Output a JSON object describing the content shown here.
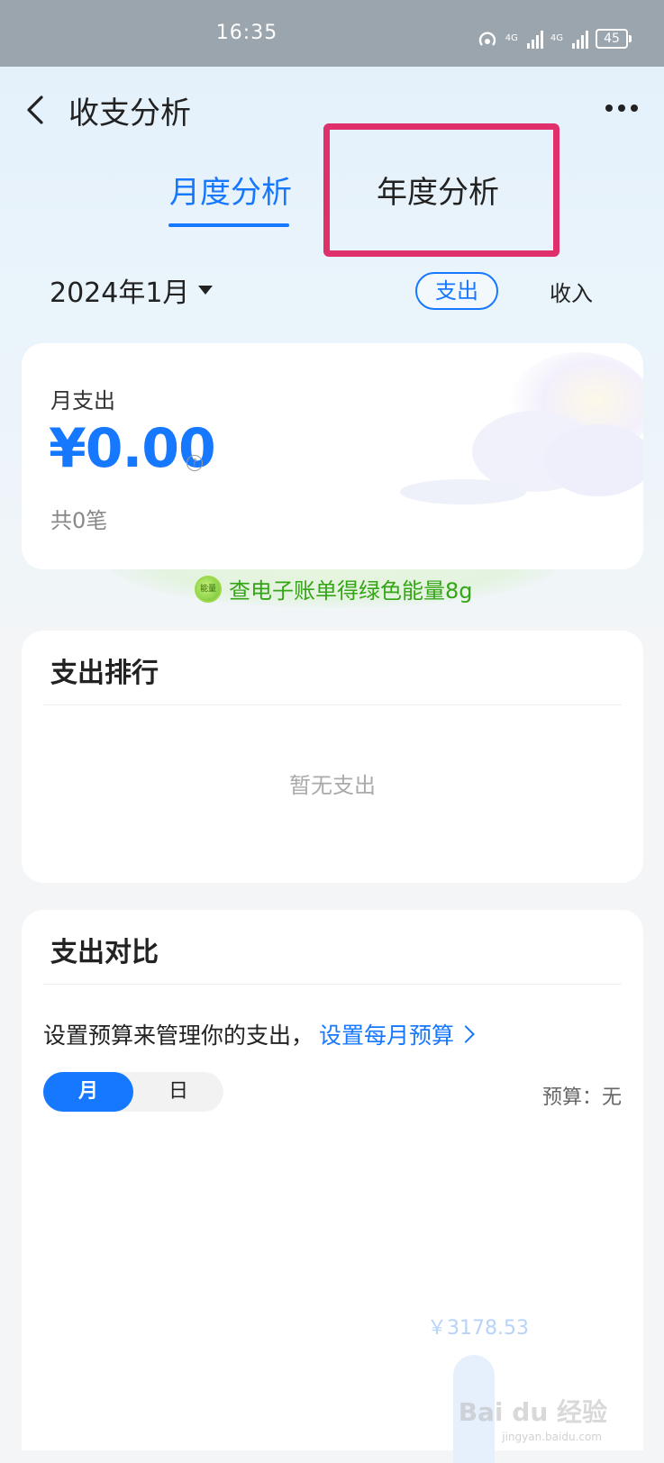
{
  "status_bar": {
    "time": "16:35",
    "battery": "45",
    "network1": "4G",
    "network2": "4G"
  },
  "header": {
    "title": "收支分析"
  },
  "tabs": [
    {
      "label": "月度分析"
    },
    {
      "label": "年度分析"
    }
  ],
  "filter": {
    "month": "2024年1月",
    "expense_label": "支出",
    "income_label": "收入"
  },
  "summary": {
    "label": "月支出",
    "amount": "¥0.00",
    "count": "共0笔"
  },
  "energy": {
    "icon_text": "能量",
    "text": "查电子账单得绿色能量8g"
  },
  "ranking": {
    "title": "支出排行",
    "empty_text": "暂无支出"
  },
  "comparison": {
    "title": "支出对比",
    "budget_prompt": "设置预算来管理你的支出，",
    "budget_link": "设置每月预算",
    "segment_month": "月",
    "segment_day": "日",
    "budget_value": "预算：无",
    "bar_value_label": "￥3178.53"
  },
  "watermark": {
    "text": "Bai du 经验",
    "sub": "jingyan.baidu.com"
  },
  "colors": {
    "accent": "#1677ff",
    "highlight": "#e0306b",
    "energy": "#34a515"
  }
}
